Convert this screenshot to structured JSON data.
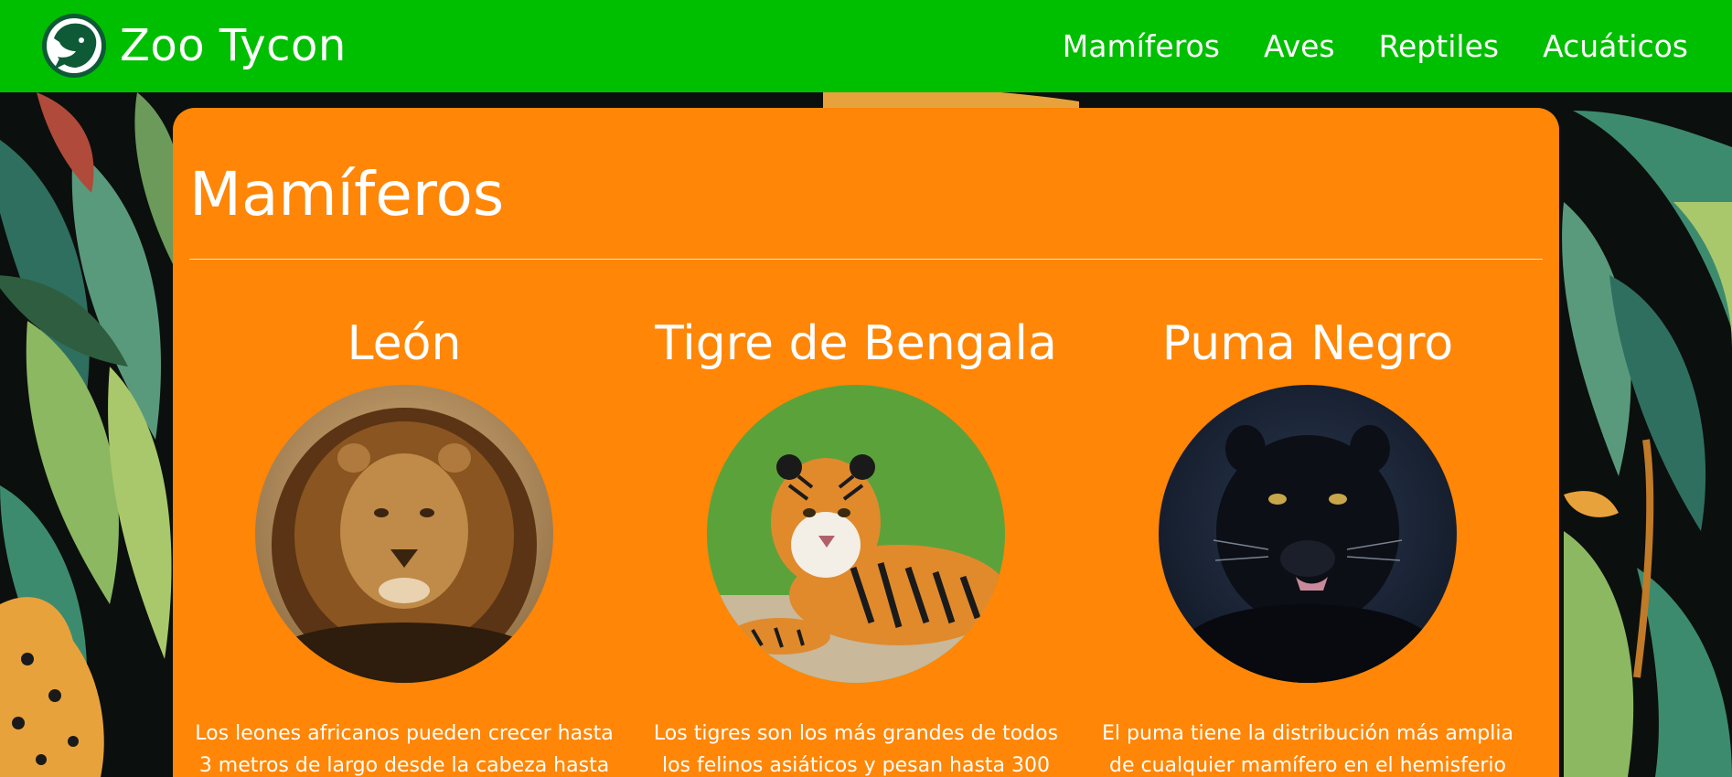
{
  "brand": {
    "name": "Zoo Tycon",
    "logo_icon": "lion-head-logo-icon"
  },
  "nav": {
    "items": [
      {
        "label": "Mamíferos"
      },
      {
        "label": "Aves"
      },
      {
        "label": "Reptiles"
      },
      {
        "label": "Acuáticos"
      }
    ]
  },
  "main": {
    "title": "Mamíferos",
    "animals": [
      {
        "name": "León",
        "image": "lion-photo",
        "description": "Los leones africanos pueden crecer hasta 3 metros de largo desde la cabeza hasta la"
      },
      {
        "name": "Tigre de Bengala",
        "image": "bengal-tiger-photo",
        "description": "Los tigres son los más grandes de todos los felinos asiáticos y pesan hasta 300"
      },
      {
        "name": "Puma Negro",
        "image": "black-puma-photo",
        "description": "El puma tiene la distribución más amplia de cualquier mamífero en el hemisferio"
      }
    ]
  },
  "colors": {
    "navbar": "#00bf00",
    "card": "#ff8606",
    "text": "#ffffff",
    "background": "#0b0f0d"
  }
}
